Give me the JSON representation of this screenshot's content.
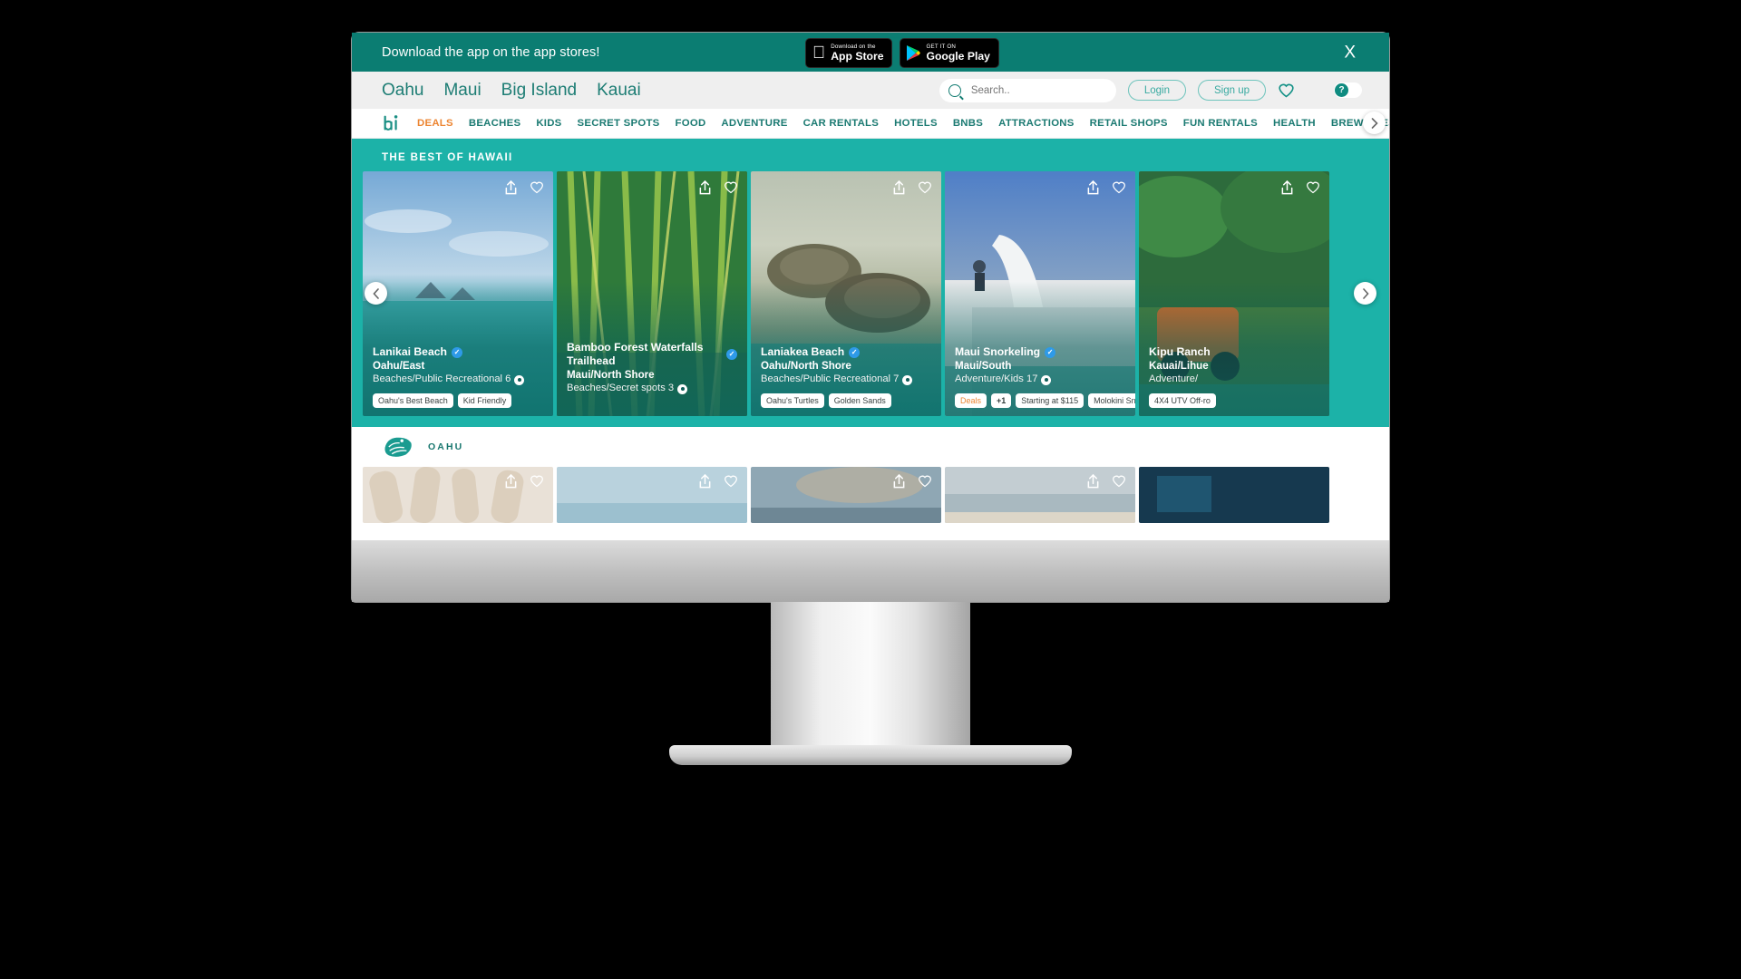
{
  "app_banner": {
    "message": "Download the app on the app stores!",
    "app_store": {
      "small": "Download on the",
      "big": "App Store"
    },
    "google_play": {
      "small": "GET IT ON",
      "big": "Google Play"
    },
    "close_label": "X"
  },
  "island_nav": {
    "items": [
      "Oahu",
      "Maui",
      "Big Island",
      "Kauai"
    ],
    "search_placeholder": "Search..",
    "login_label": "Login",
    "signup_label": "Sign up"
  },
  "category_nav": {
    "brand": "hi",
    "active": "DEALS",
    "items": [
      "DEALS",
      "BEACHES",
      "KIDS",
      "SECRET SPOTS",
      "FOOD",
      "ADVENTURE",
      "CAR RENTALS",
      "HOTELS",
      "BNBS",
      "ATTRACTIONS",
      "RETAIL SHOPS",
      "FUN RENTALS",
      "HEALTH",
      "BREWERIES"
    ]
  },
  "hero": {
    "title": "THE BEST OF HAWAII",
    "cards": [
      {
        "name": "Lanikai Beach",
        "location": "Oahu/East",
        "meta": "Beaches/Public Recreational 6",
        "verified": true,
        "tags": [
          "Oahu's Best Beach",
          "Kid Friendly"
        ]
      },
      {
        "name": "Bamboo Forest Waterfalls Trailhead",
        "location": "Maui/North Shore",
        "meta": "Beaches/Secret spots 3",
        "verified": true,
        "tags": []
      },
      {
        "name": "Laniakea Beach",
        "location": "Oahu/North Shore",
        "meta": "Beaches/Public Recreational 7",
        "verified": true,
        "tags": [
          "Oahu's Turtles",
          "Golden Sands"
        ]
      },
      {
        "name": "Maui Snorkeling",
        "location": "Maui/South",
        "meta": "Adventure/Kids 17",
        "verified": true,
        "tags": [
          "Deals",
          "+1",
          "Starting at $115",
          "Molokini Snorkeling"
        ]
      },
      {
        "name": "Kipu Ranch",
        "location": "Kauai/Lihue",
        "meta": "Adventure/",
        "verified": false,
        "tags": [
          "4X4 UTV Off-ro"
        ]
      }
    ]
  },
  "oahu_section": {
    "label": "OAHU"
  },
  "colors": {
    "brand_teal": "#0b7d72",
    "hero_teal": "#1cb2a8",
    "accent_orange": "#ec8532",
    "link_teal": "#1d7d74"
  }
}
